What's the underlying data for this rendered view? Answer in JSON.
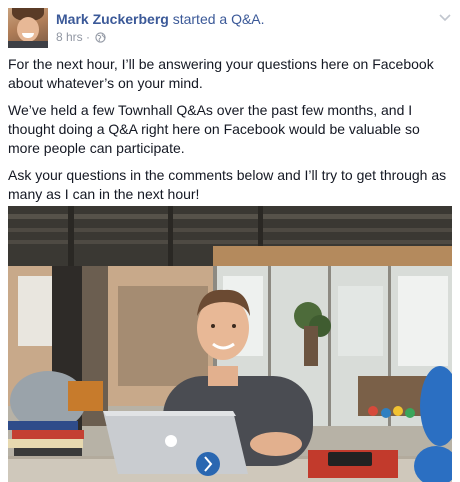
{
  "post": {
    "author": "Mark Zuckerberg",
    "action": "started a Q&A.",
    "time": "8 hrs",
    "separator": "·",
    "privacy_icon": "globe-icon",
    "menu_icon": "chevron-down-icon",
    "paragraphs": [
      "For the next hour, I’ll be answering your questions here on Facebook about whatever’s on your mind.",
      "We’ve held a few Townhall Q&As over the past few months, and I thought doing a Q&A right here on Facebook would be valuable so more people can participate.",
      "Ask your questions in the comments below and I’ll try to get through as many as I can in the next hour!"
    ],
    "photo_description_icon": "office-photo"
  },
  "colors": {
    "link": "#3b5998",
    "text": "#141823",
    "meta": "#9197a3"
  }
}
